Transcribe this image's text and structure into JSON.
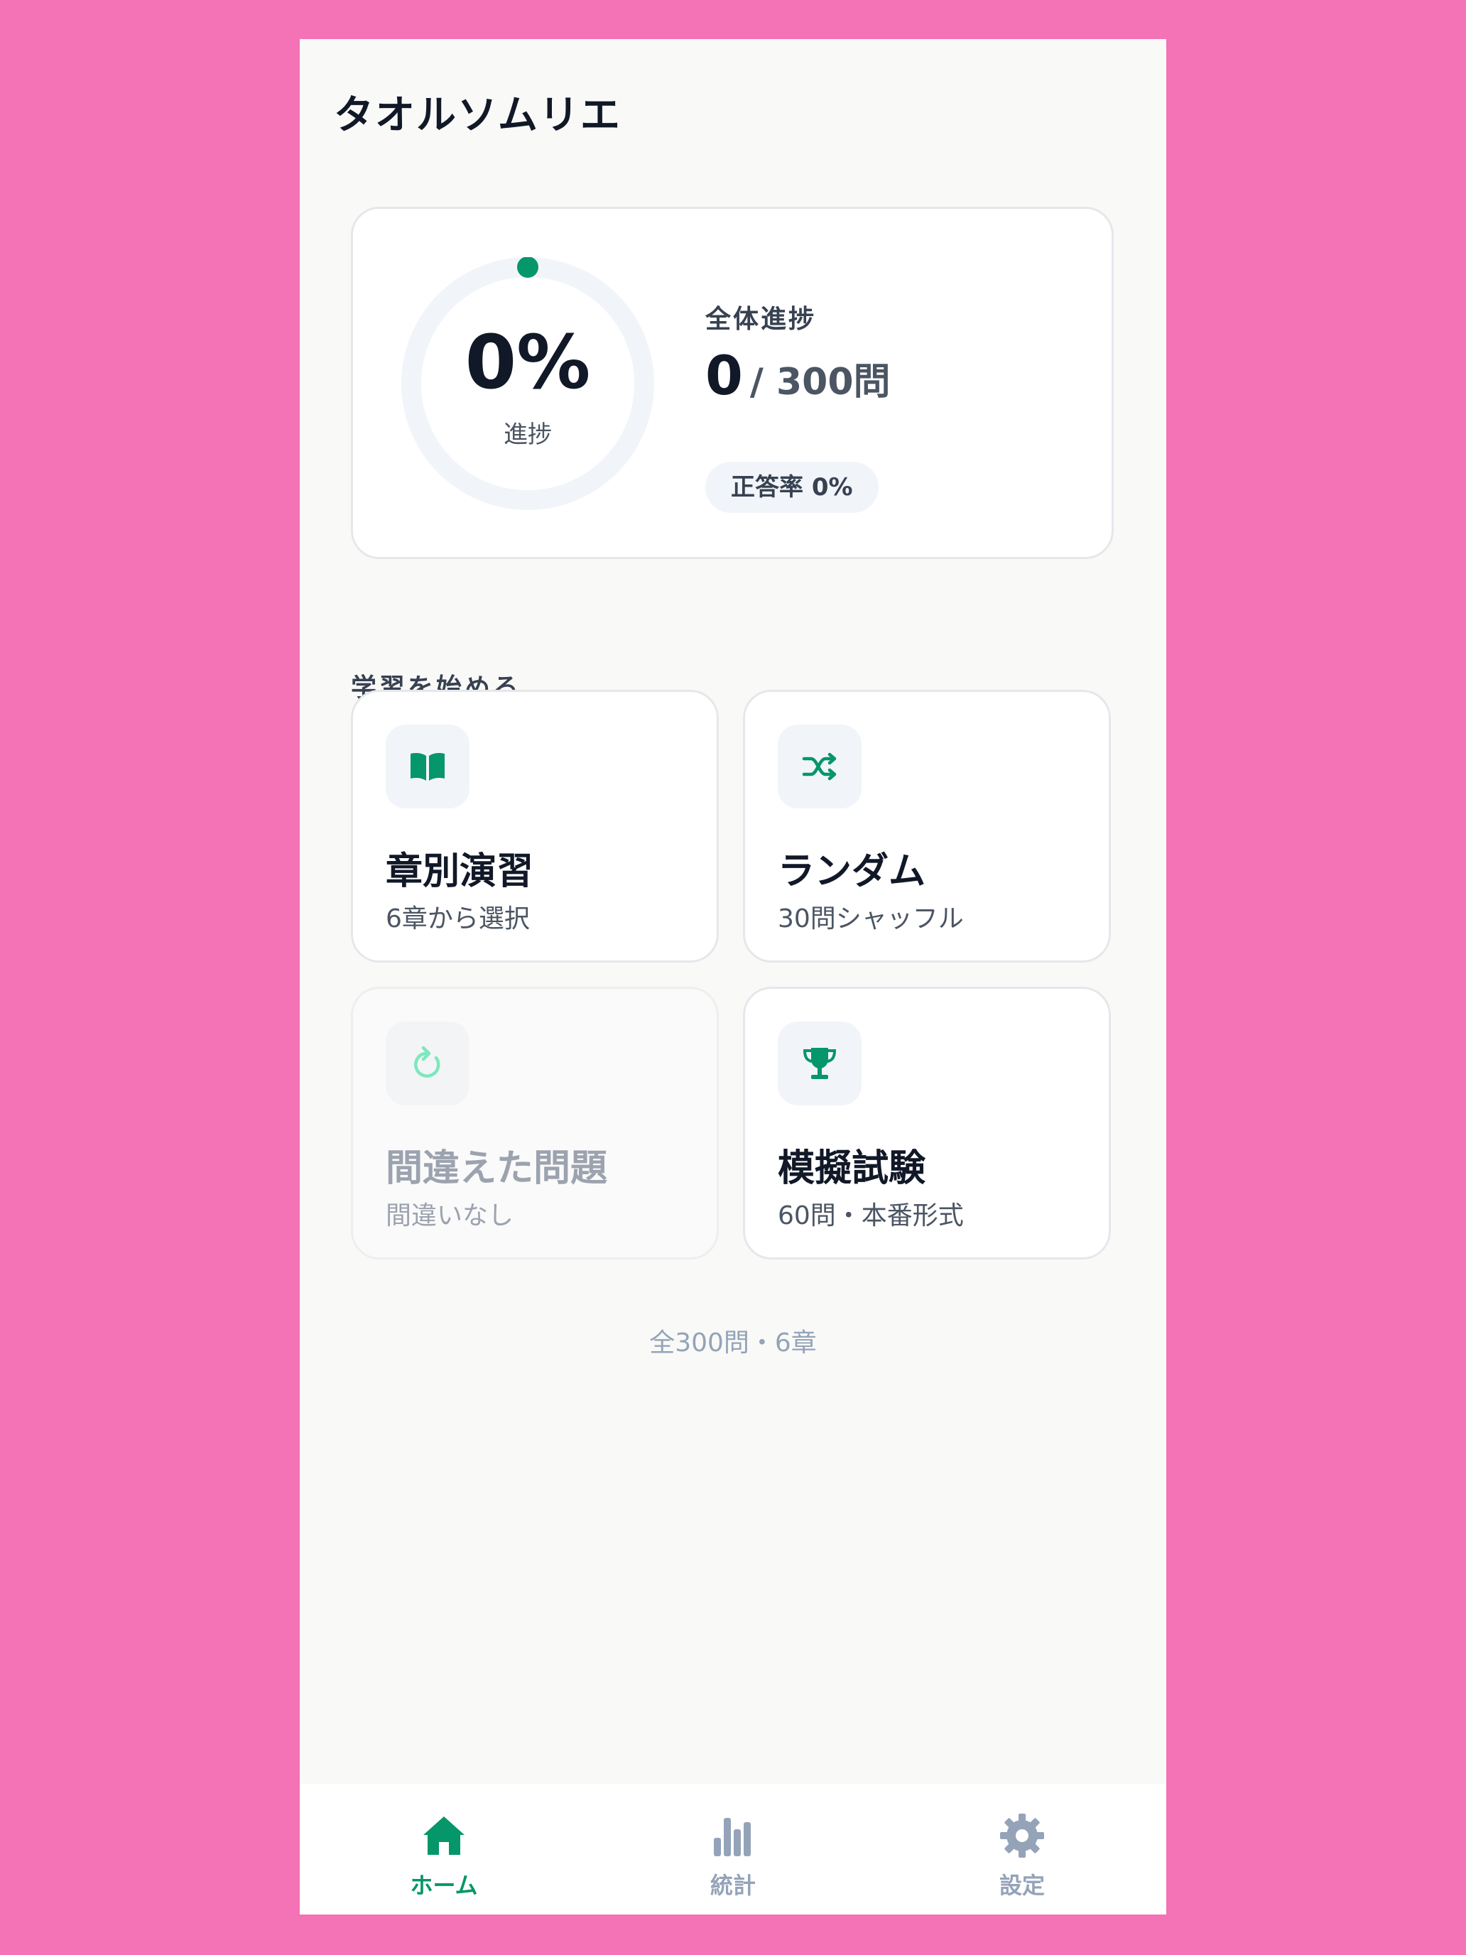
{
  "app": {
    "title": "タオルソムリエ"
  },
  "progress": {
    "percent_text": "0%",
    "percent_value": 0,
    "ring_label": "進捗",
    "overall_label": "全体進捗",
    "done_count": "0",
    "total_text": "/ 300問",
    "accuracy_text": "正答率 0%"
  },
  "study": {
    "section_title": "学習を始める",
    "modes": [
      {
        "title": "章別演習",
        "subtitle": "6章から選択",
        "icon": "book-icon",
        "enabled": true
      },
      {
        "title": "ランダム",
        "subtitle": "30問シャッフル",
        "icon": "shuffle-icon",
        "enabled": true
      },
      {
        "title": "間違えた問題",
        "subtitle": "間違いなし",
        "icon": "retry-icon",
        "enabled": false
      },
      {
        "title": "模擬試験",
        "subtitle": "60問・本番形式",
        "icon": "trophy-icon",
        "enabled": true
      }
    ]
  },
  "footer_note": "全300問・6章",
  "nav": {
    "items": [
      {
        "label": "ホーム",
        "icon": "home-icon",
        "active": true
      },
      {
        "label": "統計",
        "icon": "bar-chart-icon",
        "active": false
      },
      {
        "label": "設定",
        "icon": "gear-icon",
        "active": false
      }
    ]
  },
  "colors": {
    "accent": "#059669",
    "background": "#F472B6",
    "screen": "#F9F9F7",
    "inactive": "#94A3B8"
  }
}
